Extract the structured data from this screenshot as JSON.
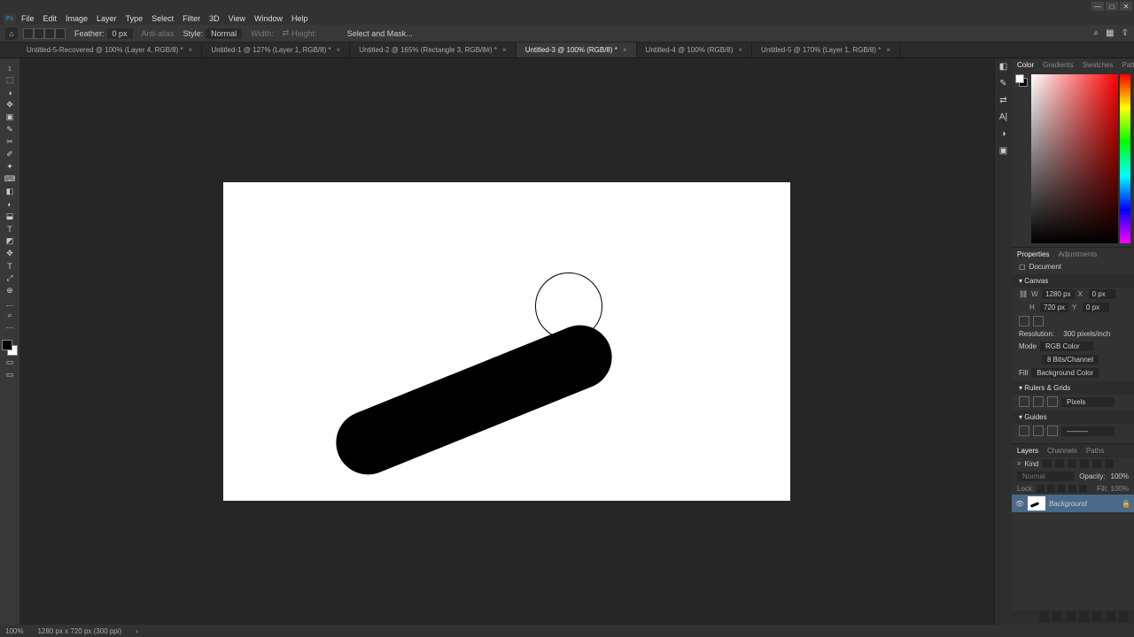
{
  "window": {
    "minimize": "—",
    "maximize": "□",
    "close": "✕"
  },
  "app_logo": "Ps",
  "menu": [
    "File",
    "Edit",
    "Image",
    "Layer",
    "Type",
    "Select",
    "Filter",
    "3D",
    "View",
    "Window",
    "Help"
  ],
  "options": {
    "feather_label": "Feather:",
    "feather_value": "0 px",
    "antialias": "Anti-alias",
    "style_label": "Style:",
    "style_value": "Normal",
    "width_label": "Width:",
    "height_label": "Height:",
    "select_mask": "Select and Mask..."
  },
  "doc_tabs": [
    {
      "label": "Untitled-5-Recovered @ 100% (Layer 4, RGB/8) *",
      "active": false
    },
    {
      "label": "Untitled-1 @ 127% (Layer 1, RGB/8) *",
      "active": false
    },
    {
      "label": "Untitled-2 @ 165% (Rectangle 3, RGB/8#) *",
      "active": false
    },
    {
      "label": "Untitled-3 @ 100% (RGB/8) *",
      "active": true
    },
    {
      "label": "Untitled-4 @ 100% (RGB/8)",
      "active": false
    },
    {
      "label": "Untitled-5 @ 170% (Layer 1, RGB/8) *",
      "active": false
    }
  ],
  "tools": {
    "list": [
      "↕",
      "⬚",
      "◑",
      "✥",
      "▣",
      "✎",
      "✂",
      "✐",
      "✦",
      "⌨",
      "◧",
      "◐",
      "⬓",
      "T",
      "◩",
      "✥",
      "⤢",
      "⊕",
      "…",
      "⋯",
      "▭",
      "▭"
    ]
  },
  "right_collapsed": [
    "◧",
    "✎",
    "⇄",
    "A|",
    "◑",
    "▣"
  ],
  "color_panel_tabs": [
    "Color",
    "Gradients",
    "Swatches",
    "Patterns"
  ],
  "properties": {
    "tabs": [
      "Properties",
      "Adjustments"
    ],
    "doc_label": "Document",
    "canvas_section": "Canvas",
    "w_label": "W",
    "w_value": "1280 px",
    "h_label": "H",
    "h_value": "720 px",
    "x_label": "X",
    "x_value": "0 px",
    "y_label": "Y",
    "y_value": "0 px",
    "resolution_label": "Resolution:",
    "resolution_value": "300 pixels/inch",
    "mode_label": "Mode",
    "mode_value": "RGB Color",
    "depth_value": "8 Bits/Channel",
    "fill_label": "Fill",
    "fill_value": "Background Color",
    "rulers_section": "Rulers & Grids",
    "rulers_unit": "Pixels",
    "guides_section": "Guides"
  },
  "layers": {
    "tabs": [
      "Layers",
      "Channels",
      "Paths"
    ],
    "kind_label": "Kind",
    "blend_mode": "Normal",
    "opacity_label": "Opacity:",
    "opacity_value": "100%",
    "lock_label": "Lock:",
    "fill_label": "Fill:",
    "fill_value": "100%",
    "layer_name": "Background"
  },
  "status": {
    "zoom": "100%",
    "info": "1280 px x 720 px (300 ppi)"
  }
}
